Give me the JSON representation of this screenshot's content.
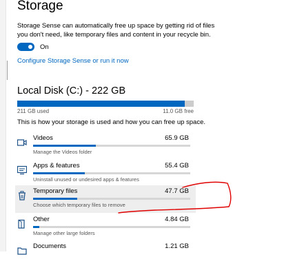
{
  "page": {
    "title": "Storage",
    "description": "Storage Sense can automatically free up space by getting rid of files you don't need, like temporary files and content in your recycle bin.",
    "toggle_state": "On",
    "configure_link": "Configure Storage Sense or run it now"
  },
  "disk": {
    "title": "Local Disk (C:) - 222 GB",
    "used_label": "211 GB used",
    "free_label": "11.0 GB free",
    "used_fraction": 0.95,
    "howto": "This is how your storage is used and how you can free up space."
  },
  "categories": [
    {
      "name": "Videos",
      "size": "65.9 GB",
      "sub": "Manage the Videos folder",
      "icon": "video-icon",
      "fraction": 0.4
    },
    {
      "name": "Apps & features",
      "size": "55.4 GB",
      "sub": "Uninstall unused or undesired apps & features",
      "icon": "apps-icon",
      "fraction": 0.33
    },
    {
      "name": "Temporary files",
      "size": "47.7 GB",
      "sub": "Choose which temporary files to remove",
      "icon": "trash-icon",
      "fraction": 0.28
    },
    {
      "name": "Other",
      "size": "4.84 GB",
      "sub": "Manage other large folders",
      "icon": "other-icon",
      "fraction": 0.04
    },
    {
      "name": "Documents",
      "size": "1.21 GB",
      "sub": "",
      "icon": "folder-icon",
      "fraction": 0.01
    }
  ],
  "colors": {
    "accent": "#0067c0",
    "annotation": "#e00000"
  }
}
